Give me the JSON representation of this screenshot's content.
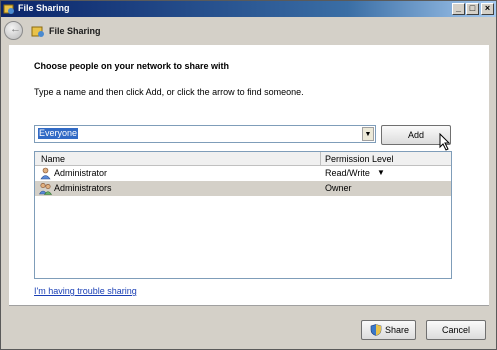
{
  "window": {
    "title": "File Sharing",
    "controls": [
      "minimize",
      "maximize",
      "close"
    ]
  },
  "header": {
    "title": "File Sharing",
    "back_icon": "back-arrow-icon"
  },
  "content": {
    "heading": "Choose people on your network to share with",
    "instruction": "Type a name and then click Add, or click the arrow to find someone.",
    "combo_value": "Everyone",
    "add_label": "Add",
    "table": {
      "columns": [
        "Name",
        "Permission Level"
      ],
      "rows": [
        {
          "name": "Administrator",
          "permission": "Read/Write",
          "icon": "user-icon",
          "has_dropdown": true
        },
        {
          "name": "Administrators",
          "permission": "Owner",
          "icon": "group-icon",
          "has_dropdown": false
        }
      ]
    },
    "trouble_link": "I'm having trouble sharing"
  },
  "footer": {
    "share_label": "Share",
    "cancel_label": "Cancel"
  },
  "colors": {
    "titlebar": "#0a246a",
    "selection": "#316ac5",
    "link": "#1a3fb5"
  }
}
